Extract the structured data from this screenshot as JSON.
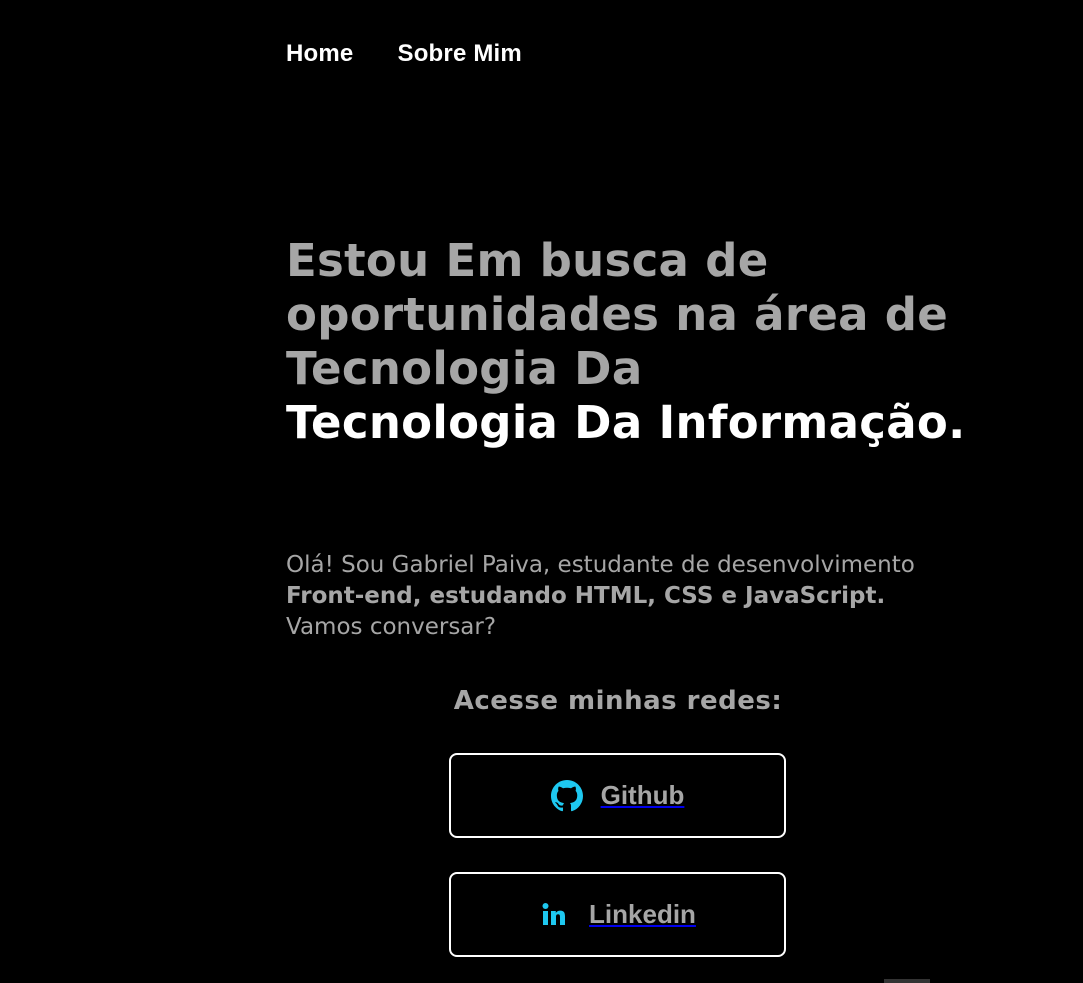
{
  "nav": {
    "items": [
      {
        "label": "Home"
      },
      {
        "label": "Sobre Mim"
      }
    ]
  },
  "hero": {
    "headline_muted": "Estou Em busca de oportunidades na área de Tecnologia Da",
    "headline_bright": "Tecnologia Da Informação."
  },
  "intro": {
    "text_1": "Olá! Sou Gabriel Paiva, estudante de desenvolvimento ",
    "text_bold": "Front-end, estudando HTML, CSS e JavaScript.",
    "text_2": " Vamos conversar?"
  },
  "social": {
    "title": "Acesse minhas redes:",
    "links": [
      {
        "label": "Github",
        "icon": "github-icon"
      },
      {
        "label": "Linkedin",
        "icon": "linkedin-icon"
      }
    ]
  },
  "colors": {
    "background": "#000000",
    "text_muted": "#a6a6a6",
    "text_bright": "#ffffff",
    "icon_accent": "#1ec8f0"
  }
}
